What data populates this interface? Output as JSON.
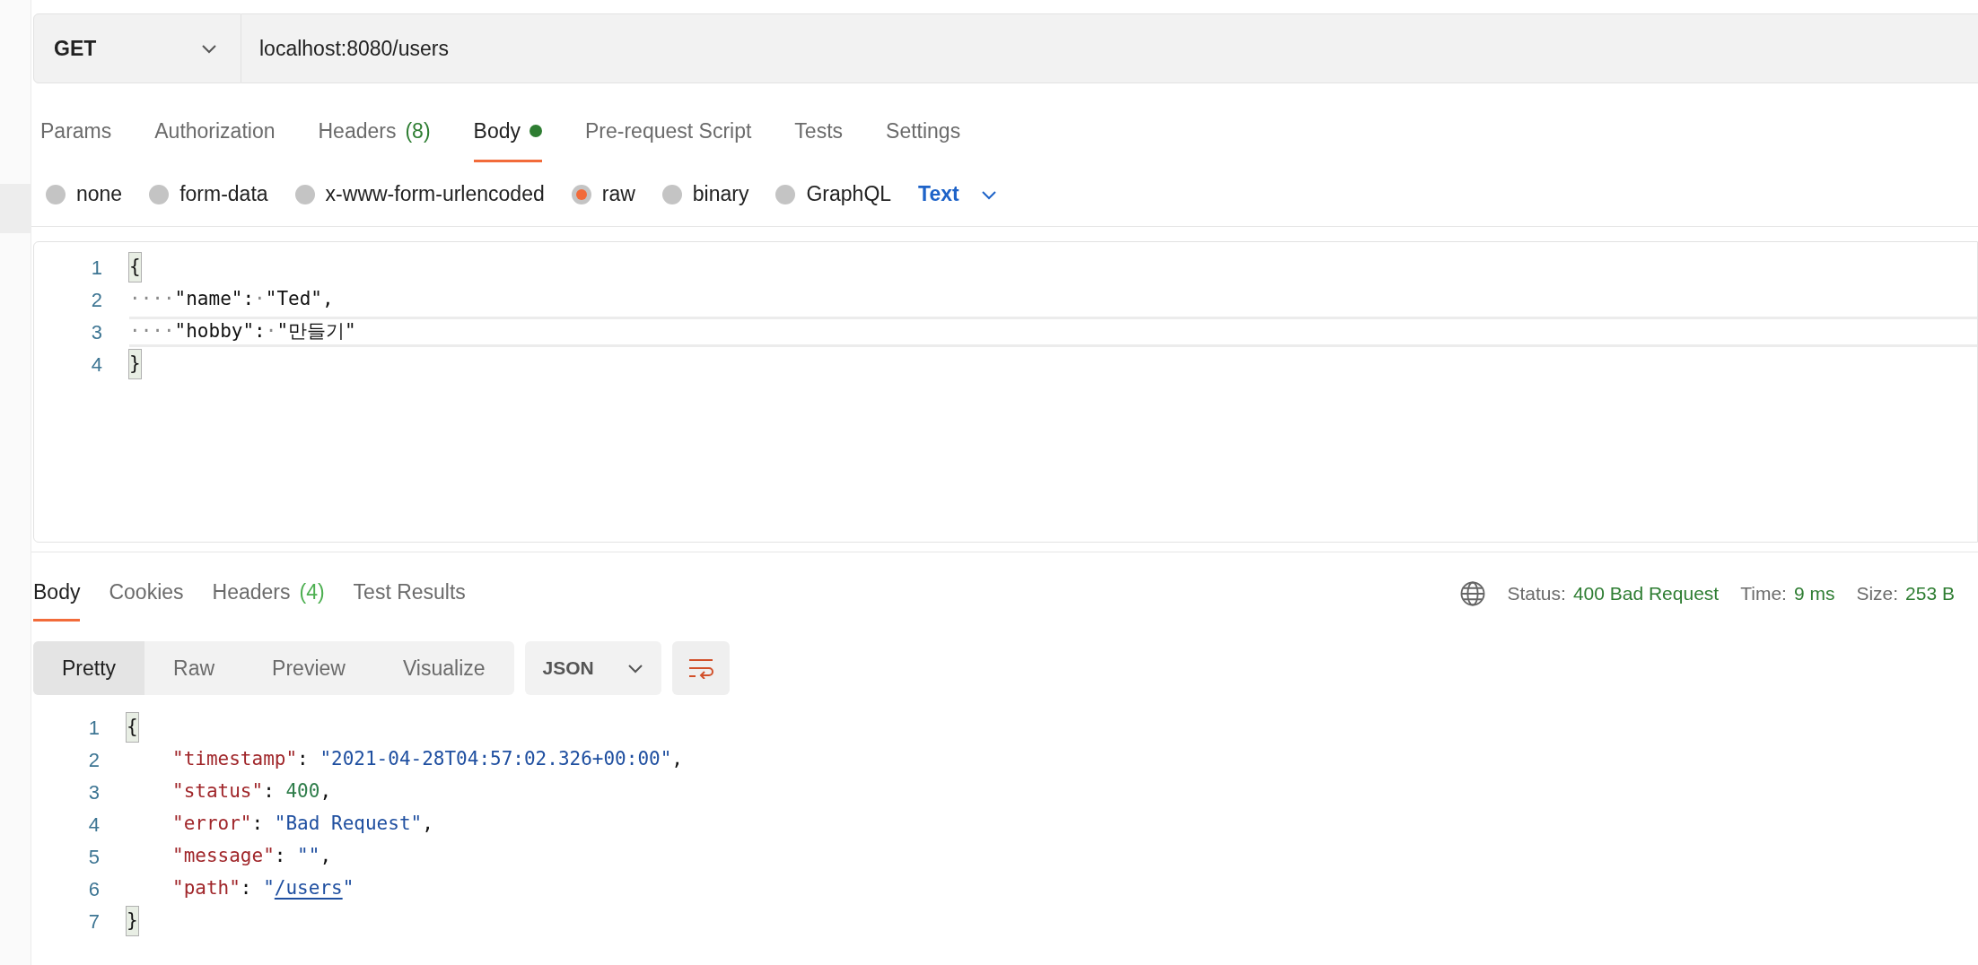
{
  "request": {
    "method": "GET",
    "url": "localhost:8080/users"
  },
  "request_tabs": [
    {
      "label": "Params",
      "selected": false
    },
    {
      "label": "Authorization",
      "selected": false
    },
    {
      "label": "Headers",
      "count": "(8)",
      "selected": false
    },
    {
      "label": "Body",
      "has_content": true,
      "selected": true
    },
    {
      "label": "Pre-request Script",
      "selected": false
    },
    {
      "label": "Tests",
      "selected": false
    },
    {
      "label": "Settings",
      "selected": false
    }
  ],
  "body_types": [
    {
      "label": "none",
      "selected": false
    },
    {
      "label": "form-data",
      "selected": false
    },
    {
      "label": "x-www-form-urlencoded",
      "selected": false
    },
    {
      "label": "raw",
      "selected": true
    },
    {
      "label": "binary",
      "selected": false
    },
    {
      "label": "GraphQL",
      "selected": false
    }
  ],
  "raw_format": "Text",
  "request_body": [
    {
      "number": "1",
      "current": false,
      "tokens": [
        {
          "kind": "bracket",
          "text": "{"
        }
      ]
    },
    {
      "number": "2",
      "current": false,
      "tokens": [
        {
          "kind": "space",
          "text": "····"
        },
        {
          "kind": "plain",
          "text": "\"name\":"
        },
        {
          "kind": "space",
          "text": "·"
        },
        {
          "kind": "plain",
          "text": "\"Ted\","
        }
      ]
    },
    {
      "number": "3",
      "current": true,
      "tokens": [
        {
          "kind": "space",
          "text": "····"
        },
        {
          "kind": "plain",
          "text": "\"hobby\":"
        },
        {
          "kind": "space",
          "text": "·"
        },
        {
          "kind": "plain",
          "text": "\"만들기\""
        }
      ]
    },
    {
      "number": "4",
      "current": false,
      "tokens": [
        {
          "kind": "bracket",
          "text": "}"
        }
      ]
    }
  ],
  "response_tabs": [
    {
      "label": "Body",
      "selected": true
    },
    {
      "label": "Cookies",
      "selected": false
    },
    {
      "label": "Headers",
      "count": "(4)",
      "selected": false
    },
    {
      "label": "Test Results",
      "selected": false
    }
  ],
  "response_meta": [
    {
      "label": "Status:",
      "value": "400 Bad Request"
    },
    {
      "label": "Time:",
      "value": "9 ms"
    },
    {
      "label": "Size:",
      "value": "253 B"
    }
  ],
  "view_modes": [
    {
      "label": "Pretty",
      "selected": true
    },
    {
      "label": "Raw",
      "selected": false
    },
    {
      "label": "Preview",
      "selected": false
    },
    {
      "label": "Visualize",
      "selected": false
    }
  ],
  "response_format": "JSON",
  "response_body": [
    {
      "number": "1",
      "tokens": [
        {
          "kind": "bracket",
          "text": "{"
        }
      ]
    },
    {
      "number": "2",
      "indented": true,
      "tokens": [
        {
          "kind": "key",
          "text": "\"timestamp\""
        },
        {
          "kind": "plain",
          "text": ": "
        },
        {
          "kind": "string",
          "text": "\"2021-04-28T04:57:02.326+00:00\""
        },
        {
          "kind": "plain",
          "text": ","
        }
      ]
    },
    {
      "number": "3",
      "indented": true,
      "tokens": [
        {
          "kind": "key",
          "text": "\"status\""
        },
        {
          "kind": "plain",
          "text": ": "
        },
        {
          "kind": "number",
          "text": "400"
        },
        {
          "kind": "plain",
          "text": ","
        }
      ]
    },
    {
      "number": "4",
      "indented": true,
      "tokens": [
        {
          "kind": "key",
          "text": "\"error\""
        },
        {
          "kind": "plain",
          "text": ": "
        },
        {
          "kind": "string",
          "text": "\"Bad Request\""
        },
        {
          "kind": "plain",
          "text": ","
        }
      ]
    },
    {
      "number": "5",
      "indented": true,
      "tokens": [
        {
          "kind": "key",
          "text": "\"message\""
        },
        {
          "kind": "plain",
          "text": ": "
        },
        {
          "kind": "string",
          "text": "\"\""
        },
        {
          "kind": "plain",
          "text": ","
        }
      ]
    },
    {
      "number": "6",
      "indented": true,
      "tokens": [
        {
          "kind": "key",
          "text": "\"path\""
        },
        {
          "kind": "plain",
          "text": ": "
        },
        {
          "kind": "string",
          "text": "\""
        },
        {
          "kind": "link",
          "text": "/users"
        },
        {
          "kind": "string",
          "text": "\""
        }
      ]
    },
    {
      "number": "7",
      "tokens": [
        {
          "kind": "bracket",
          "text": "}"
        }
      ]
    }
  ]
}
